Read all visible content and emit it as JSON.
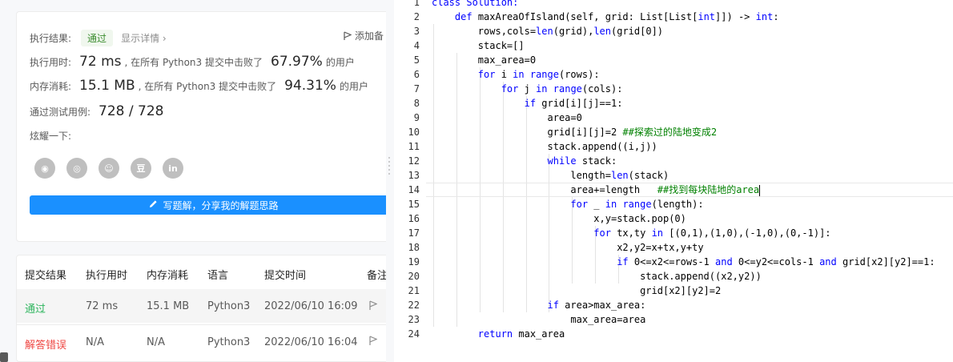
{
  "result_card": {
    "result_label": "执行结果:",
    "result_status": "通过",
    "details_link": "显示详情 ›",
    "add_note": "添加备",
    "runtime": {
      "label": "执行用时:",
      "value": "72 ms",
      "text": ", 在所有 Python3 提交中击败了",
      "percent": "67.97%",
      "suffix": "的用户"
    },
    "memory": {
      "label": "内存消耗:",
      "value": "15.1 MB",
      "text": ", 在所有 Python3 提交中击败了",
      "percent": "94.31%",
      "suffix": "的用户"
    },
    "tests": {
      "label": "通过测试用例:",
      "value": "728 / 728"
    },
    "share_label": "炫耀一下:",
    "share_icons": [
      "wechat-icon",
      "weibo-icon",
      "qq-icon",
      "douban-icon",
      "linkedin-icon"
    ],
    "share_glyphs": [
      "◉",
      "◎",
      "☺",
      "豆",
      "in"
    ],
    "write_solution": "写题解，分享我的解题思路"
  },
  "submissions": {
    "headers": [
      "提交结果",
      "执行用时",
      "内存消耗",
      "语言",
      "提交时间",
      "备注"
    ],
    "rows": [
      {
        "status": "通过",
        "time": "72 ms",
        "memory": "15.1 MB",
        "lang": "Python3",
        "date": "2022/06/10 16:09"
      },
      {
        "status": "解答错误",
        "time": "N/A",
        "memory": "N/A",
        "lang": "Python3",
        "date": "2022/06/10 16:04"
      }
    ]
  },
  "editor": {
    "line_numbers": [
      "1",
      "2",
      "3",
      "4",
      "5",
      "6",
      "7",
      "8",
      "9",
      "10",
      "11",
      "12",
      "13",
      "14",
      "15",
      "16",
      "17",
      "18",
      "19",
      "20",
      "21",
      "22",
      "23",
      "24"
    ],
    "lines": [
      [
        {
          "t": "class Solution:",
          "k": "k"
        }
      ],
      [
        {
          "t": "    "
        },
        {
          "t": "def",
          "k": "k"
        },
        {
          "t": " maxAreaOfIsland(self, grid: List[List["
        },
        {
          "t": "int",
          "k": "k"
        },
        {
          "t": "]]) -> "
        },
        {
          "t": "int",
          "k": "k"
        },
        {
          "t": ":"
        }
      ],
      [
        {
          "t": "        rows,cols="
        },
        {
          "t": "len",
          "k": "k"
        },
        {
          "t": "(grid),"
        },
        {
          "t": "len",
          "k": "k"
        },
        {
          "t": "(grid[0])"
        }
      ],
      [
        {
          "t": "        stack=[]"
        }
      ],
      [
        {
          "t": "        max_area=0"
        }
      ],
      [
        {
          "t": "        "
        },
        {
          "t": "for",
          "k": "k"
        },
        {
          "t": " i "
        },
        {
          "t": "in",
          "k": "k"
        },
        {
          "t": " "
        },
        {
          "t": "range",
          "k": "k"
        },
        {
          "t": "(rows):"
        }
      ],
      [
        {
          "t": "            "
        },
        {
          "t": "for",
          "k": "k"
        },
        {
          "t": " j "
        },
        {
          "t": "in",
          "k": "k"
        },
        {
          "t": " "
        },
        {
          "t": "range",
          "k": "k"
        },
        {
          "t": "(cols):"
        }
      ],
      [
        {
          "t": "                "
        },
        {
          "t": "if",
          "k": "k"
        },
        {
          "t": " grid[i][j]==1:"
        }
      ],
      [
        {
          "t": "                    area=0"
        }
      ],
      [
        {
          "t": "                    grid[i][j]=2 "
        },
        {
          "t": "##探索过的陆地变成2",
          "k": "c"
        }
      ],
      [
        {
          "t": "                    stack.append((i,j))"
        }
      ],
      [
        {
          "t": "                    "
        },
        {
          "t": "while",
          "k": "k"
        },
        {
          "t": " stack:"
        }
      ],
      [
        {
          "t": "                        length="
        },
        {
          "t": "len",
          "k": "k"
        },
        {
          "t": "(stack)"
        }
      ],
      [
        {
          "t": "                        area+=length   "
        },
        {
          "t": "##找到每块陆地的area",
          "k": "c"
        }
      ],
      [
        {
          "t": "                        "
        },
        {
          "t": "for",
          "k": "k"
        },
        {
          "t": " _ "
        },
        {
          "t": "in",
          "k": "k"
        },
        {
          "t": " "
        },
        {
          "t": "range",
          "k": "k"
        },
        {
          "t": "(length):"
        }
      ],
      [
        {
          "t": "                            x,y=stack.pop(0)"
        }
      ],
      [
        {
          "t": "                            "
        },
        {
          "t": "for",
          "k": "k"
        },
        {
          "t": " tx,ty "
        },
        {
          "t": "in",
          "k": "k"
        },
        {
          "t": " [(0,1),(1,0),(-1,0),(0,-1)]:"
        }
      ],
      [
        {
          "t": "                                x2,y2=x+tx,y+ty"
        }
      ],
      [
        {
          "t": "                                "
        },
        {
          "t": "if",
          "k": "k"
        },
        {
          "t": " 0<=x2<=rows-1 "
        },
        {
          "t": "and",
          "k": "k"
        },
        {
          "t": " 0<=y2<=cols-1 "
        },
        {
          "t": "and",
          "k": "k"
        },
        {
          "t": " grid[x2][y2]==1:"
        }
      ],
      [
        {
          "t": "                                    stack.append((x2,y2))"
        }
      ],
      [
        {
          "t": "                                    grid[x2][y2]=2"
        }
      ],
      [
        {
          "t": "                    "
        },
        {
          "t": "if",
          "k": "k"
        },
        {
          "t": " area>max_area:"
        }
      ],
      [
        {
          "t": "                        max_area=area"
        }
      ],
      [
        {
          "t": "        "
        },
        {
          "t": "return",
          "k": "k"
        },
        {
          "t": " max_area"
        }
      ]
    ],
    "active_line": 14
  },
  "colors": {
    "accent": "#1a90ff",
    "pass": "#2db55d",
    "fail": "#ef4743",
    "keyword": "#0000ff",
    "comment": "#008000"
  }
}
